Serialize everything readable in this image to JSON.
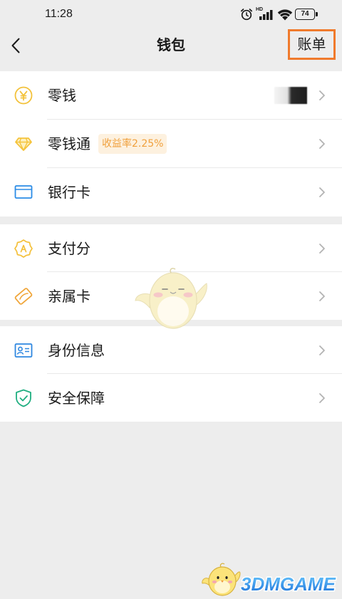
{
  "status_bar": {
    "time": "11:28",
    "network_label": "HD",
    "battery": "74",
    "icons": [
      "alarm-clock-icon",
      "signal-icon",
      "wifi-icon",
      "battery-icon"
    ]
  },
  "header": {
    "back_icon": "chevron-left-icon",
    "title": "钱包",
    "bill_label": "账单",
    "bill_highlight_color": "#f07a2c"
  },
  "sections": [
    {
      "items": [
        {
          "label": "零钱",
          "icon": "yuan-coin-icon",
          "icon_color": "#f3c23c"
        },
        {
          "label": "零钱通",
          "icon": "diamond-icon",
          "icon_color": "#f5c33b",
          "badge": "收益率2.25%"
        },
        {
          "label": "银行卡",
          "icon": "bank-card-icon",
          "icon_color": "#2b8ce6"
        }
      ]
    },
    {
      "items": [
        {
          "label": "支付分",
          "icon": "credit-score-badge-icon",
          "icon_color": "#f4c03a"
        },
        {
          "label": "亲属卡",
          "icon": "family-card-icon",
          "icon_color": "#f0a63a"
        }
      ]
    },
    {
      "items": [
        {
          "label": "身份信息",
          "icon": "id-card-icon",
          "icon_color": "#2e87e0"
        },
        {
          "label": "安全保障",
          "icon": "shield-check-icon",
          "icon_color": "#1fae80"
        }
      ]
    }
  ],
  "row_chevron_icon": "chevron-right-icon",
  "watermark": {
    "brand": "3DMGAME",
    "mascot_icon": "chick-mascot-icon"
  },
  "colors": {
    "page_background": "#ededed",
    "list_background": "#ffffff",
    "text": "#1a1a1a",
    "chevron": "#b3b3b3",
    "badge_text": "#f0a03c",
    "badge_background": "#fdf1df",
    "divider": "#e9e9e9"
  }
}
